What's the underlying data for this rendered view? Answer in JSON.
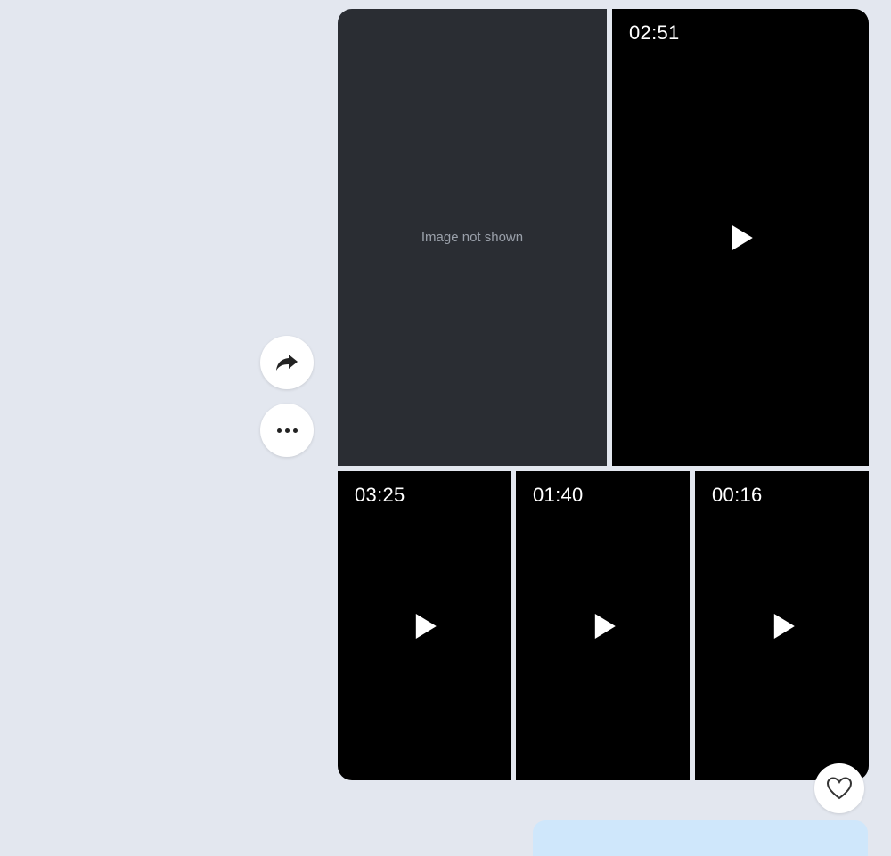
{
  "media_group": {
    "image_tile": {
      "placeholder_label": "Image not shown"
    },
    "videos": [
      {
        "duration": "02:51"
      },
      {
        "duration": "03:25"
      },
      {
        "duration": "01:40"
      },
      {
        "duration": "00:16"
      }
    ]
  },
  "actions": {
    "share_icon": "share-arrow-icon",
    "more_icon": "more-dots-icon",
    "like_icon": "heart-outline-icon"
  },
  "colors": {
    "background": "#e3e7ef",
    "video_background": "#000000",
    "outgoing_bubble": "#cfe7fb"
  }
}
